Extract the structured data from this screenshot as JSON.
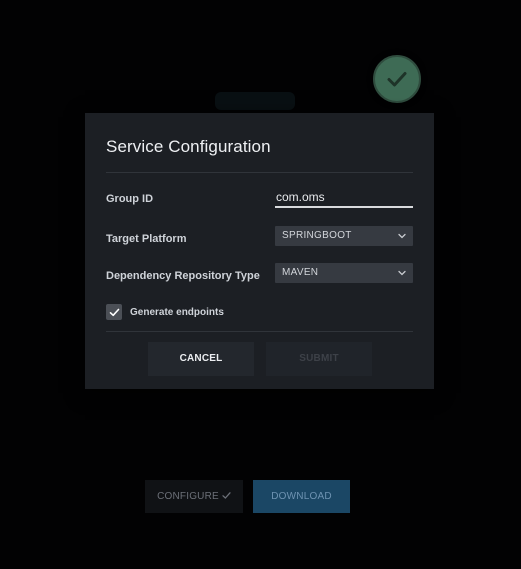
{
  "dialog": {
    "title": "Service Configuration",
    "fields": {
      "group_id_label": "Group ID",
      "group_id_value": "com.oms",
      "target_platform_label": "Target Platform",
      "target_platform_value": "SPRINGBOOT",
      "repo_type_label": "Dependency Repository Type",
      "repo_type_value": "MAVEN"
    },
    "generate_endpoints": {
      "label": "Generate endpoints",
      "checked": true
    },
    "buttons": {
      "cancel": "CANCEL",
      "submit": "SUBMIT"
    }
  },
  "footer": {
    "configure_label": "CONFIGURE",
    "download_label": "DOWNLOAD"
  },
  "icons": {
    "success": "check-circle-icon",
    "dropdown": "chevron-down-icon",
    "checkbox": "check-icon"
  },
  "colors": {
    "success_badge": "#3e6b55",
    "download_button": "#1b4765",
    "dialog_background": "#1c1f24"
  }
}
